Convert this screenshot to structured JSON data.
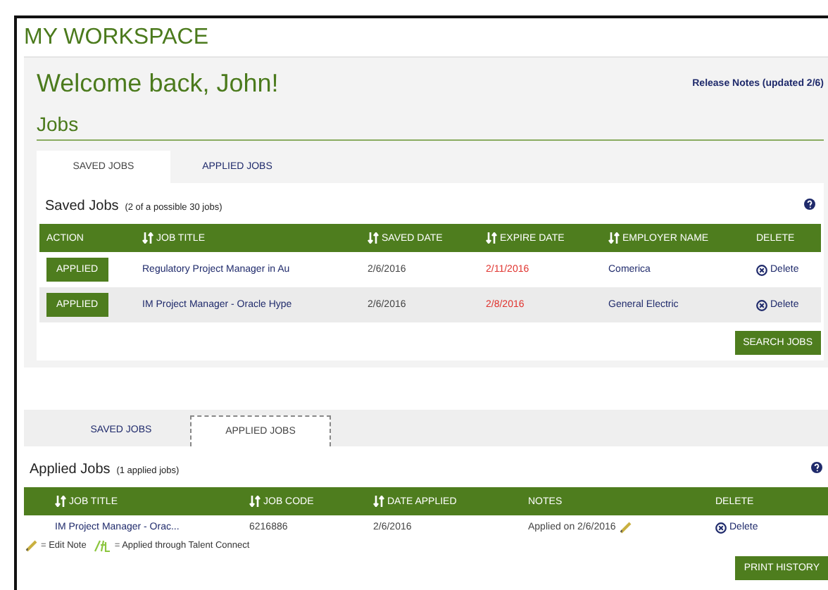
{
  "page_title": "MY WORKSPACE",
  "welcome": "Welcome back, John!",
  "release_notes": "Release Notes (updated 2/6)",
  "section_title": "Jobs",
  "saved_section": {
    "tabs": [
      {
        "label": "SAVED JOBS",
        "selected": true
      },
      {
        "label": "APPLIED JOBS",
        "selected": false
      }
    ],
    "title": "Saved Jobs",
    "subtitle": "(2 of a possible 30 jobs)",
    "columns": [
      {
        "label": "ACTION",
        "sortable": false
      },
      {
        "label": "JOB TITLE",
        "sortable": true
      },
      {
        "label": "SAVED DATE",
        "sortable": true
      },
      {
        "label": "EXPIRE DATE",
        "sortable": true
      },
      {
        "label": "EMPLOYER NAME",
        "sortable": true
      },
      {
        "label": "DELETE",
        "sortable": false
      }
    ],
    "rows": [
      {
        "action": "APPLIED",
        "job_title": "Regulatory Project Manager in Au",
        "saved_date": "2/6/2016",
        "expire_date": "2/11/2016",
        "expiring": true,
        "employer": "Comerica",
        "delete": "Delete"
      },
      {
        "action": "APPLIED",
        "job_title": "IM Project Manager - Oracle Hype",
        "saved_date": "2/6/2016",
        "expire_date": "2/8/2016",
        "expiring": true,
        "employer": "General Electric",
        "delete": "Delete"
      }
    ],
    "button": "SEARCH JOBS"
  },
  "applied_section": {
    "tabs": [
      {
        "label": "SAVED JOBS",
        "selected": false
      },
      {
        "label": "APPLIED JOBS",
        "selected": true
      }
    ],
    "title": "Applied Jobs",
    "subtitle": "(1 applied jobs)",
    "columns": [
      {
        "label": "JOB TITLE",
        "sortable": true
      },
      {
        "label": "JOB CODE",
        "sortable": true
      },
      {
        "label": "DATE APPLIED",
        "sortable": true
      },
      {
        "label": "NOTES",
        "sortable": false
      },
      {
        "label": "DELETE",
        "sortable": false
      }
    ],
    "rows": [
      {
        "job_title": "IM Project Manager - Orac...",
        "job_code": "6216886",
        "date_applied": "2/6/2016",
        "notes": "Applied on 2/6/2016",
        "delete": "Delete"
      }
    ],
    "legend": [
      {
        "kind": "pencil",
        "text": "= Edit Note"
      },
      {
        "kind": "talent",
        "text": "= Applied through Talent Connect"
      }
    ],
    "button": "PRINT HISTORY"
  }
}
